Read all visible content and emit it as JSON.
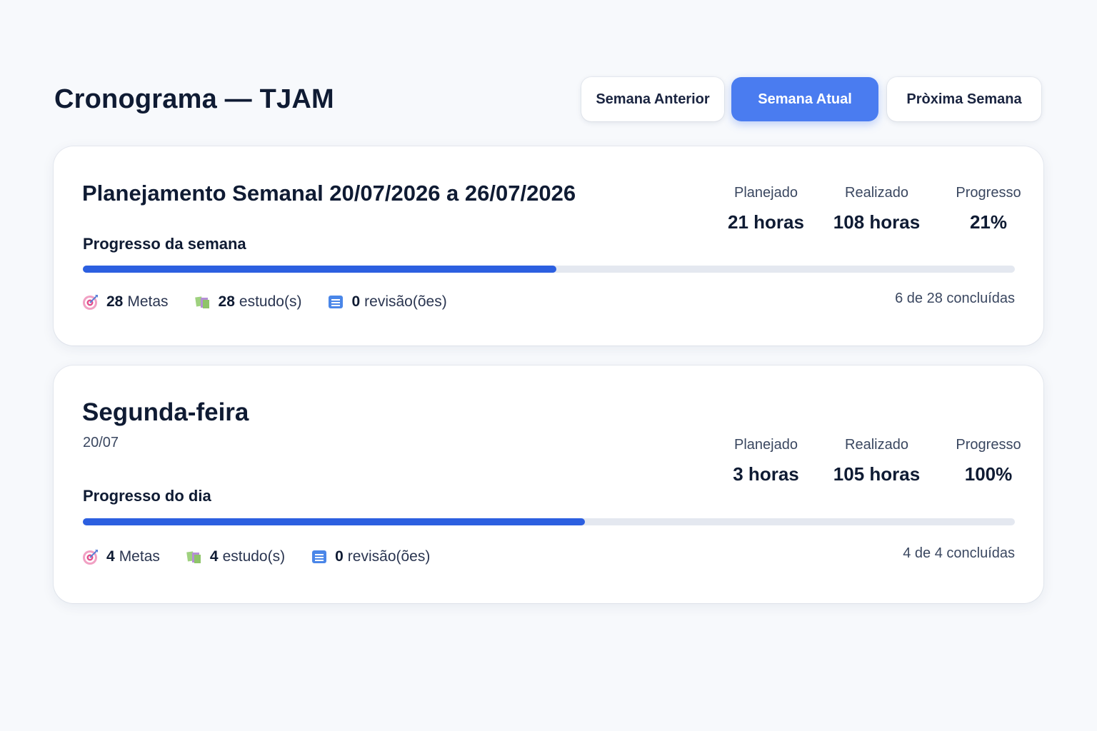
{
  "header": {
    "title": "Cronograma — TJAM",
    "nav": {
      "prev_label": "Semana Anterior",
      "current_label": "Semana Atual",
      "next_label": "Pròxima Semana"
    }
  },
  "colors": {
    "accent": "#4a7cf0",
    "progress_fill": "#2c5fe0",
    "progress_track": "#e4e8f0"
  },
  "week_card": {
    "title": "Planejamento Semanal 20/07/2026 a 26/07/2026",
    "progress_label": "Progresso da semana",
    "progress_fill_fraction": 0.508,
    "stats": [
      {
        "label": "Planejado",
        "value": "21 horas"
      },
      {
        "label": "Realizado",
        "value": "108 horas"
      },
      {
        "label": "Progresso",
        "value": "21%"
      }
    ],
    "counts": {
      "metas_num": "28",
      "metas_label": "Metas",
      "metas_icon": "target-icon",
      "estudos_num": "28",
      "estudos_label": "estudo(s)",
      "estudos_icon": "books-icon",
      "revisoes_num": "0",
      "revisoes_label": "revisão(ões)",
      "revisoes_icon": "document-icon"
    },
    "completed": "6 de 28 concluídas"
  },
  "day_card": {
    "title": "Segunda-feira",
    "date": "20/07",
    "progress_label": "Progresso do dia",
    "progress_fill_fraction": 0.539,
    "stats": [
      {
        "label": "Planejado",
        "value": "3 horas"
      },
      {
        "label": "Realizado",
        "value": "105 horas"
      },
      {
        "label": "Progresso",
        "value": "100%"
      }
    ],
    "counts": {
      "metas_num": "4",
      "metas_label": "Metas",
      "metas_icon": "target-icon",
      "estudos_num": "4",
      "estudos_label": "estudo(s)",
      "estudos_icon": "books-icon",
      "revisoes_num": "0",
      "revisoes_label": "revisão(ões)",
      "revisoes_icon": "document-icon"
    },
    "completed": "4 de 4 concluídas"
  }
}
